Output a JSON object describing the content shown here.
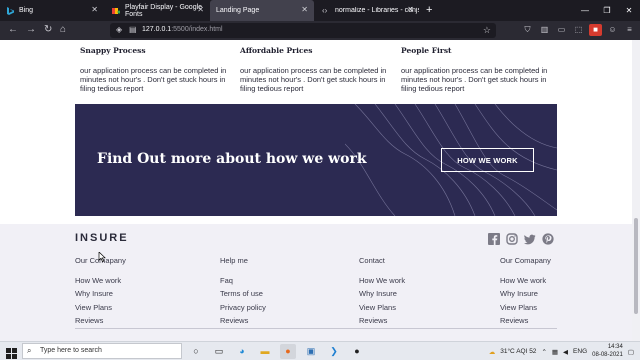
{
  "browser": {
    "tabs": [
      {
        "title": "Bing",
        "active": false,
        "icon": "bing-icon"
      },
      {
        "title": "Playfair Display - Google Fonts",
        "active": false,
        "icon": "google-fonts-icon"
      },
      {
        "title": "Landing Page",
        "active": true,
        "icon": ""
      },
      {
        "title": "normalize - Libraries - cdnjs - Th",
        "active": false,
        "icon": "code-icon"
      }
    ],
    "new_tab": "+",
    "url_host": "127.0.0.1",
    "url_rest": ":5500/index.html"
  },
  "page": {
    "features": [
      {
        "title": "Snappy Process",
        "text": "our application process can be completed in minutes not hour's . Don't get stuck hours in filing tedious report"
      },
      {
        "title": "Affordable Prices",
        "text": "our application process can be completed in minutes not hour's . Don't get stuck hours in filing tedious report"
      },
      {
        "title": "People First",
        "text": "our application process can be completed in minutes not hour's . Don't get stuck hours in filing tedious report"
      }
    ],
    "banner": {
      "heading": "Find Out more about how we work",
      "button": "HOW WE WORK",
      "bg_color": "#2c2a52"
    },
    "footer": {
      "logo": "INSURE",
      "social": [
        "facebook-icon",
        "instagram-icon",
        "twitter-icon",
        "pinterest-icon"
      ],
      "columns": [
        {
          "heading": "Our Comapany",
          "links": [
            "How We work",
            "Why Insure",
            "View Plans",
            "Reviews"
          ]
        },
        {
          "heading": "Help me",
          "links": [
            "Faq",
            "Terms of use",
            "Privacy policy",
            "Reviews"
          ]
        },
        {
          "heading": "Contact",
          "links": [
            "How We work",
            "Why Insure",
            "View Plans",
            "Reviews"
          ]
        },
        {
          "heading": "Our Comapany",
          "links": [
            "How We work",
            "Why Insure",
            "View Plans",
            "Reviews"
          ]
        }
      ]
    }
  },
  "taskbar": {
    "search_placeholder": "Type here to search",
    "weather": "31°C AQI 52",
    "language": "ENG",
    "time": "14:34",
    "date": "08-08-2021"
  }
}
